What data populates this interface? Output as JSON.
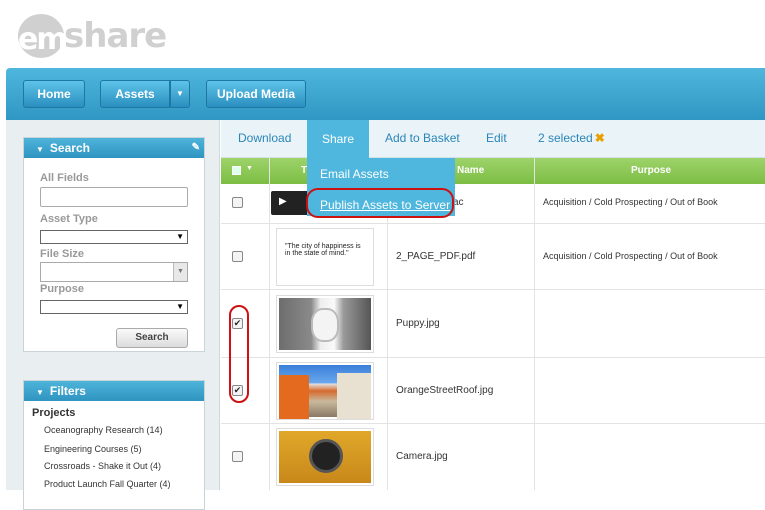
{
  "logo": {
    "prefix": "em",
    "word": "share"
  },
  "nav": {
    "home": "Home",
    "assets": "Assets",
    "assets_dropdown": "▼",
    "upload": "Upload Media"
  },
  "search_panel": {
    "title": "Search",
    "labels": {
      "all_fields": "All Fields",
      "asset_type": "Asset Type",
      "file_size": "File Size",
      "purpose": "Purpose"
    },
    "button": "Search"
  },
  "filters_panel": {
    "title": "Filters",
    "projects_title": "Projects",
    "projects": [
      "Oceanography Research (14)",
      "Engineering Courses (5)",
      "Crossroads - Shake it Out (4)",
      "Product Launch Fall Quarter (4)"
    ]
  },
  "tabs": {
    "download": "Download",
    "share": "Share",
    "add_to_basket": "Add to Basket",
    "edit": "Edit",
    "selected": "2 selected",
    "clear": "✖"
  },
  "share_menu": {
    "email": "Email Assets",
    "publish": "Publish Assets to Server"
  },
  "table": {
    "headers": {
      "thumb": "T",
      "name": "Name",
      "purpose": "Purpose"
    },
    "rows": [
      {
        "name": "ac",
        "purpose": "Acquisition / Cold Prospecting / Out of Book",
        "checked": false
      },
      {
        "name": "2_PAGE_PDF.pdf",
        "purpose": "Acquisition / Cold Prospecting / Out of Book",
        "checked": false,
        "thumb_text": "\"The city of happiness is in the state of mind.\""
      },
      {
        "name": "Puppy.jpg",
        "purpose": "",
        "checked": true
      },
      {
        "name": "OrangeStreetRoof.jpg",
        "purpose": "",
        "checked": true
      },
      {
        "name": "Camera.jpg",
        "purpose": "",
        "checked": false
      }
    ]
  },
  "colors": {
    "accent": "#4fb6dd",
    "header_green": "#8cc757",
    "highlight_red": "#cc1111"
  },
  "icons": {
    "play": "play-icon",
    "edit": "edit-icon",
    "dropdown": "triangle-down-icon"
  }
}
